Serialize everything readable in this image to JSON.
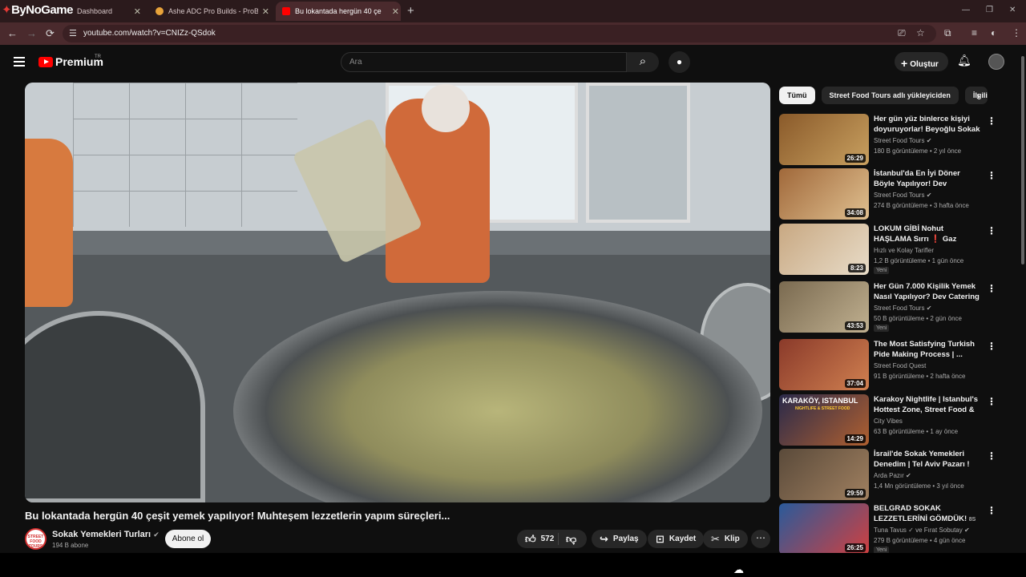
{
  "branding": {
    "overlay_logo": "ByNoGame"
  },
  "browser": {
    "tabs": [
      {
        "label": "Dashboard",
        "color": "#555"
      },
      {
        "label": "Ashe ADC Pro Builds - ProBuild:",
        "color": "#e8a33a"
      },
      {
        "label": "Bu lokantada hergün 40 çe",
        "color": "#ff0000"
      }
    ],
    "url": "youtube.com/watch?v=CNIZz-QSdok"
  },
  "yt": {
    "logo_text": "Premium",
    "country": "TR",
    "search_placeholder": "Ara",
    "create_label": "Oluştur"
  },
  "video": {
    "title": "Bu lokantada hergün 40 çeşit yemek yapılıyor! Muhteşem lezzetlerin yapım süreçleri...",
    "channel": "Sokak Yemekleri Turları",
    "subscribers": "194 B abone",
    "subscribe_label": "Abone ol",
    "likes": "572",
    "share_label": "Paylaş",
    "save_label": "Kaydet",
    "clip_label": "Klip",
    "channel_avatar_text": "STREET FOOD TOURS"
  },
  "chips": [
    "Tümü",
    "Street Food Tours adlı yükleyiciden",
    "İlgili"
  ],
  "recommendations": [
    {
      "title": "Her gün yüz binlerce kişiyi doyuruyorlar! Beyoğlu Sokak ...",
      "channel": "Street Food Tours",
      "verified": true,
      "meta": "180 B görüntüleme • 2 yıl önce",
      "duration": "26:29",
      "new": "",
      "thumb_colors": [
        "#8a5a2a",
        "#c8a060"
      ]
    },
    {
      "title": "İstanbul'da En İyi Döner Böyle Yapılıyor! Dev Restoranda Tam...",
      "channel": "Street Food Tours",
      "verified": true,
      "meta": "274 B görüntüleme • 3 hafta önce",
      "duration": "34:08",
      "new": "",
      "thumb_colors": [
        "#a0683a",
        "#e0c090"
      ]
    },
    {
      "title": "LOKUM GİBİ Nohut HAŞLAMA Sırrı ❗ Gaz Yapmaz Kabuk ...",
      "channel": "Hızlı ve Kolay Tarifler",
      "verified": false,
      "meta": "1,2 B görüntüleme • 1 gün önce",
      "duration": "8:23",
      "new": "Yeni",
      "thumb_colors": [
        "#c8a882",
        "#e8dcc8"
      ]
    },
    {
      "title": "Her Gün 7.000 Kişilik Yemek Nasıl Yapılıyor? Dev Catering ...",
      "channel": "Street Food Tours",
      "verified": true,
      "meta": "50 B görüntüleme • 2 gün önce",
      "duration": "43:53",
      "new": "Yeni",
      "thumb_colors": [
        "#7a6a50",
        "#c0b090"
      ]
    },
    {
      "title": "The Most Satisfying Turkish Pide Making Process | ...",
      "channel": "Street Food Quest",
      "verified": false,
      "meta": "91 B görüntüleme • 2 hafta önce",
      "duration": "37:04",
      "new": "",
      "thumb_colors": [
        "#8a3a2a",
        "#d08050"
      ]
    },
    {
      "title": "Karakoy Nightlife | Istanbul's Hottest Zone, Street Food & ...",
      "channel": "City Vibes",
      "verified": false,
      "meta": "63 B görüntüleme • 1 ay önce",
      "duration": "14:29",
      "new": "",
      "thumb_colors": [
        "#2a2a4a",
        "#b06030"
      ],
      "thumb_text": "KARAKÖY, ISTANBUL",
      "thumb_sub": "NIGHTLIFE & STREET FOOD"
    },
    {
      "title": "İsrail'de Sokak Yemekleri Denedim | Tel Aviv Pazarı ! -15...",
      "channel": "Arda Pazır",
      "verified": true,
      "meta": "1,4 Mn görüntüleme • 3 yıl önce",
      "duration": "29:59",
      "new": "",
      "thumb_colors": [
        "#5a4a3a",
        "#a08060"
      ]
    },
    {
      "title": "BELGRAD SOKAK LEZZETLERİNİ GÖMDÜK!",
      "channel": "Tuna Tavus ✓ ve Fırat Sobutay",
      "verified": true,
      "meta": "279 B görüntüleme • 4 gün önce",
      "duration": "26:25",
      "new": "Yeni",
      "thumb_colors": [
        "#2a5a9a",
        "#d04040"
      ],
      "extra_badge": "8S"
    }
  ],
  "icons": {
    "back": "←",
    "forward": "→",
    "reload": "⟳",
    "tune": "☰",
    "star": "☆",
    "ext": "⧉",
    "profile": "◐",
    "menu": "⋮",
    "search": "⌕",
    "mic": "🎤",
    "bell": "🔔",
    "like": "👍",
    "dislike": "👎",
    "share": "↪",
    "save": "⊡",
    "clip": "✂",
    "more": "⋯"
  }
}
